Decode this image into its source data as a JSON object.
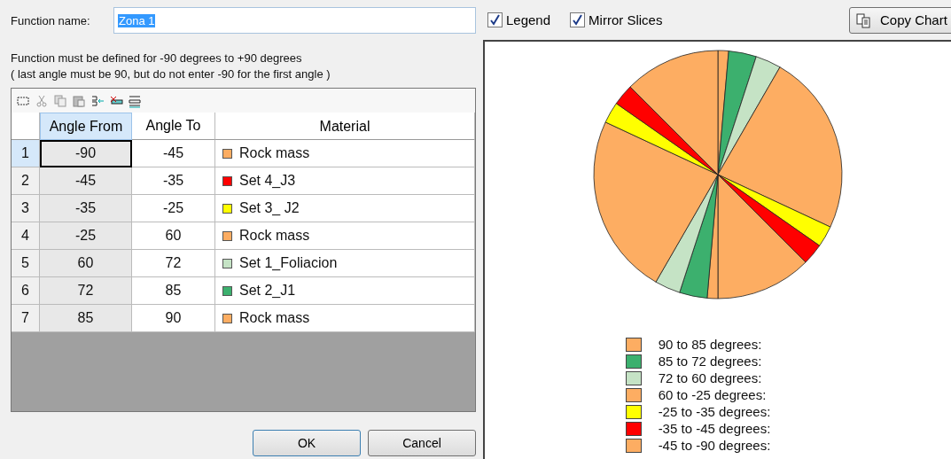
{
  "function_name": {
    "label": "Function name:",
    "value": "Zona 1"
  },
  "instructions": [
    "Function must be defined for -90 degrees to +90 degrees",
    "( last angle must be 90, but do not enter -90 for the first angle )"
  ],
  "table": {
    "columns": [
      "Angle From",
      "Angle To",
      "Material"
    ],
    "rows": [
      {
        "number": "1",
        "from": "-90",
        "to": "-45",
        "material": "Rock mass",
        "color": "#fdad62",
        "current": true
      },
      {
        "number": "2",
        "from": "-45",
        "to": "-35",
        "material": "Set 4_J3",
        "color": "#ff0000",
        "current": false
      },
      {
        "number": "3",
        "from": "-35",
        "to": "-25",
        "material": "Set 3_ J2",
        "color": "#ffff00",
        "current": false
      },
      {
        "number": "4",
        "from": "-25",
        "to": "60",
        "material": "Rock mass",
        "color": "#fdad62",
        "current": false
      },
      {
        "number": "5",
        "from": "60",
        "to": "72",
        "material": "Set 1_Foliacion",
        "color": "#c5e3c5",
        "current": false
      },
      {
        "number": "6",
        "from": "72",
        "to": "85",
        "material": "Set 2_J1",
        "color": "#3cb06e",
        "current": false
      },
      {
        "number": "7",
        "from": "85",
        "to": "90",
        "material": "Rock mass",
        "color": "#fdad62",
        "current": false
      }
    ]
  },
  "buttons": [
    "OK",
    "Cancel"
  ],
  "options": [
    {
      "label": "Legend",
      "checked": true
    },
    {
      "label": "Mirror Slices",
      "checked": true
    }
  ],
  "copy_button": "Copy Chart",
  "legend": [
    {
      "label": "90 to 85 degrees:",
      "color": "#fdad62"
    },
    {
      "label": "85 to 72 degrees:",
      "color": "#3cb06e"
    },
    {
      "label": "72 to 60 degrees:",
      "color": "#c5e3c5"
    },
    {
      "label": "60 to -25 degrees:",
      "color": "#fdad62"
    },
    {
      "label": "-25 to -35 degrees:",
      "color": "#ffff00"
    },
    {
      "label": "-35 to -45 degrees:",
      "color": "#ff0000"
    },
    {
      "label": "-45 to -90 degrees:",
      "color": "#fdad62"
    }
  ]
}
